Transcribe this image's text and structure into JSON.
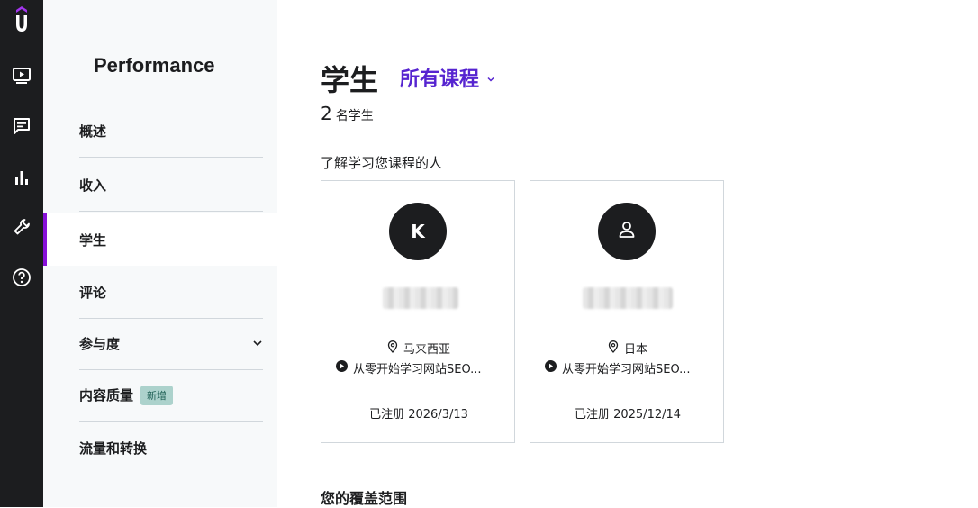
{
  "sidebar": {
    "title": "Performance",
    "items": [
      {
        "label": "概述"
      },
      {
        "label": "收入"
      },
      {
        "label": "学生"
      },
      {
        "label": "评论"
      },
      {
        "label": "参与度"
      },
      {
        "label": "内容质量",
        "badge": "新增"
      },
      {
        "label": "流量和转换"
      }
    ]
  },
  "header": {
    "title": "学生",
    "course_select": "所有课程"
  },
  "count": {
    "number": "2",
    "label": "名学生"
  },
  "section": {
    "subtitle": "了解学习您课程的人"
  },
  "students": [
    {
      "avatar_letter": "K",
      "location": "马来西亚",
      "course": "从零开始学习网站SEO...",
      "enrolled": "已注册 2026/3/13"
    },
    {
      "avatar_icon": "user-icon",
      "location": "日本",
      "course": "从零开始学习网站SEO...",
      "enrolled": "已注册 2025/12/14"
    }
  ],
  "coverage": {
    "title": "您的覆盖范围"
  },
  "colors": {
    "accent": "#8710d8",
    "link": "#5624d0",
    "rail": "#1c1d1f",
    "badge_bg": "#acd2cc"
  }
}
